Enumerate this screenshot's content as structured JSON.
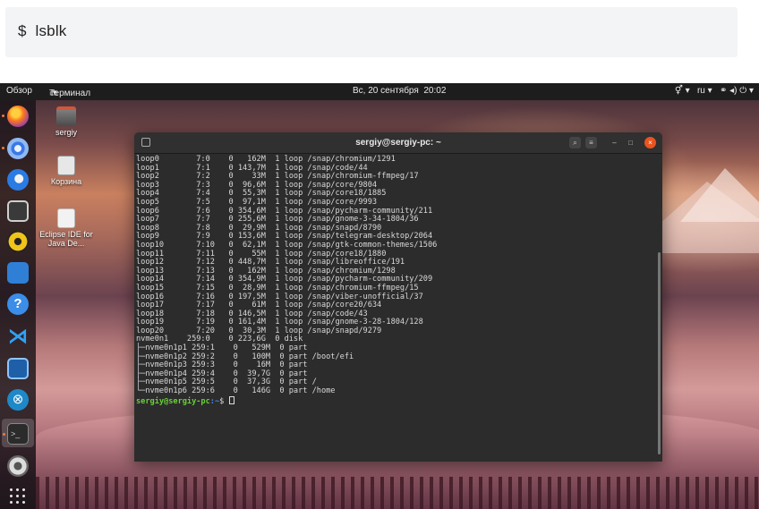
{
  "code_block": {
    "command": "$  lsblk"
  },
  "topbar": {
    "activities": "Обзор",
    "app_menu": "Терминал",
    "clock": "Вс, 20 сентября  20:02",
    "right_tray": "⚥ ▾   ru ▾   ⚭ ◂) ⏻ ▾"
  },
  "desktop": {
    "home_label": "sergiy",
    "trash_label": "Корзина",
    "eclipse_label": "Eclipse IDE for Java De..."
  },
  "dock": {
    "help_glyph": "?",
    "vscode_glyph": "⋊",
    "cross_glyph": "⊗",
    "term_glyph": ">_"
  },
  "terminal": {
    "title": "sergiy@sergiy-pc: ~",
    "lines": [
      "loop0        7:0    0   162M  1 loop /snap/chromium/1291",
      "loop1        7:1    0 143,7M  1 loop /snap/code/44",
      "loop2        7:2    0    33M  1 loop /snap/chromium-ffmpeg/17",
      "loop3        7:3    0  96,6M  1 loop /snap/core/9804",
      "loop4        7:4    0  55,3M  1 loop /snap/core18/1885",
      "loop5        7:5    0  97,1M  1 loop /snap/core/9993",
      "loop6        7:6    0 354,6M  1 loop /snap/pycharm-community/211",
      "loop7        7:7    0 255,6M  1 loop /snap/gnome-3-34-1804/36",
      "loop8        7:8    0  29,9M  1 loop /snap/snapd/8790",
      "loop9        7:9    0 153,6M  1 loop /snap/telegram-desktop/2064",
      "loop10       7:10   0  62,1M  1 loop /snap/gtk-common-themes/1506",
      "loop11       7:11   0    55M  1 loop /snap/core18/1880",
      "loop12       7:12   0 448,7M  1 loop /snap/libreoffice/191",
      "loop13       7:13   0   162M  1 loop /snap/chromium/1298",
      "loop14       7:14   0 354,9M  1 loop /snap/pycharm-community/209",
      "loop15       7:15   0  28,9M  1 loop /snap/chromium-ffmpeg/15",
      "loop16       7:16   0 197,5M  1 loop /snap/viber-unofficial/37",
      "loop17       7:17   0    61M  1 loop /snap/core20/634",
      "loop18       7:18   0 146,5M  1 loop /snap/code/43",
      "loop19       7:19   0 161,4M  1 loop /snap/gnome-3-28-1804/128",
      "loop20       7:20   0  30,3M  1 loop /snap/snapd/9279",
      "nvme0n1    259:0    0 223,6G  0 disk",
      "├─nvme0n1p1 259:1    0   529M  0 part",
      "├─nvme0n1p2 259:2    0   100M  0 part /boot/efi",
      "├─nvme0n1p3 259:3    0    16M  0 part",
      "├─nvme0n1p4 259:4    0  39,7G  0 part",
      "├─nvme0n1p5 259:5    0  37,3G  0 part /",
      "└─nvme0n1p6 259:6    0   146G  0 part /home"
    ],
    "prompt_user": "sergiy@sergiy-pc",
    "prompt_path": ":~",
    "prompt_symbol": "$ "
  },
  "colors": {
    "accent_close": "#e95420",
    "prompt_user": "#6ad03a",
    "prompt_path": "#4e86d8"
  }
}
